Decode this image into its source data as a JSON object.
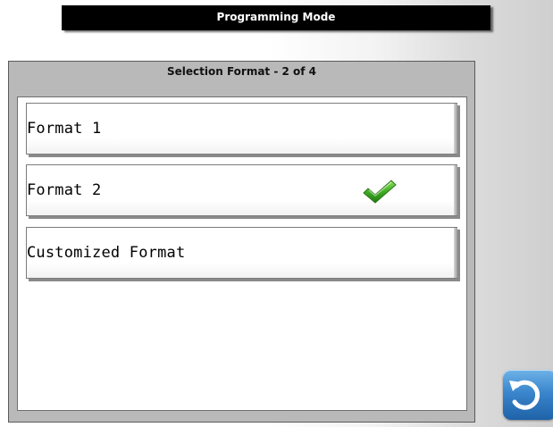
{
  "header": {
    "title": "Programming Mode"
  },
  "dialog": {
    "title": "Selection Format - 2 of 4",
    "options": [
      {
        "label": "Format 1",
        "selected": false
      },
      {
        "label": "Format 2",
        "selected": true
      },
      {
        "label": "Customized Format",
        "selected": false
      }
    ]
  },
  "icons": {
    "selected_mark": "checkmark-icon",
    "back": "back-arrow-icon"
  },
  "colors": {
    "title_bar_bg": "#000000",
    "dialog_frame": "#b9b9b9",
    "check_green": "#3a9a1e",
    "back_button_blue": "#3a86cc"
  }
}
